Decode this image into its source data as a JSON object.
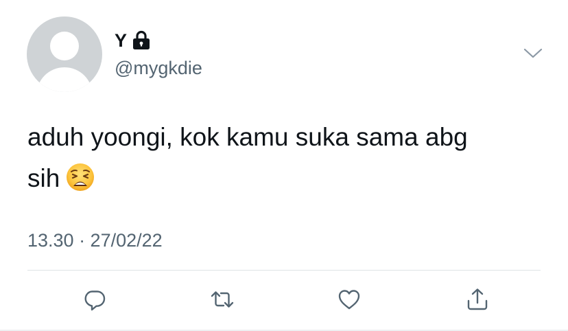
{
  "tweet": {
    "display_name": "Y",
    "handle": "@mygkdie",
    "text_line1": "aduh yoongi, kok kamu suka sama abg",
    "text_line2": "sih",
    "timestamp": "13.30 · 27/02/22"
  },
  "icons": {
    "avatar": "default-avatar",
    "lock": "lock-icon",
    "menu": "chevron-down-icon",
    "emoji": "weary-face-emoji",
    "reply": "reply-icon",
    "retweet": "retweet-icon",
    "like": "heart-icon",
    "share": "share-icon"
  },
  "colors": {
    "text": "#0f1419",
    "secondary": "#536471",
    "icon": "#536471",
    "avatar_bg": "#cfd3d6",
    "divider": "#dfe3e6"
  }
}
